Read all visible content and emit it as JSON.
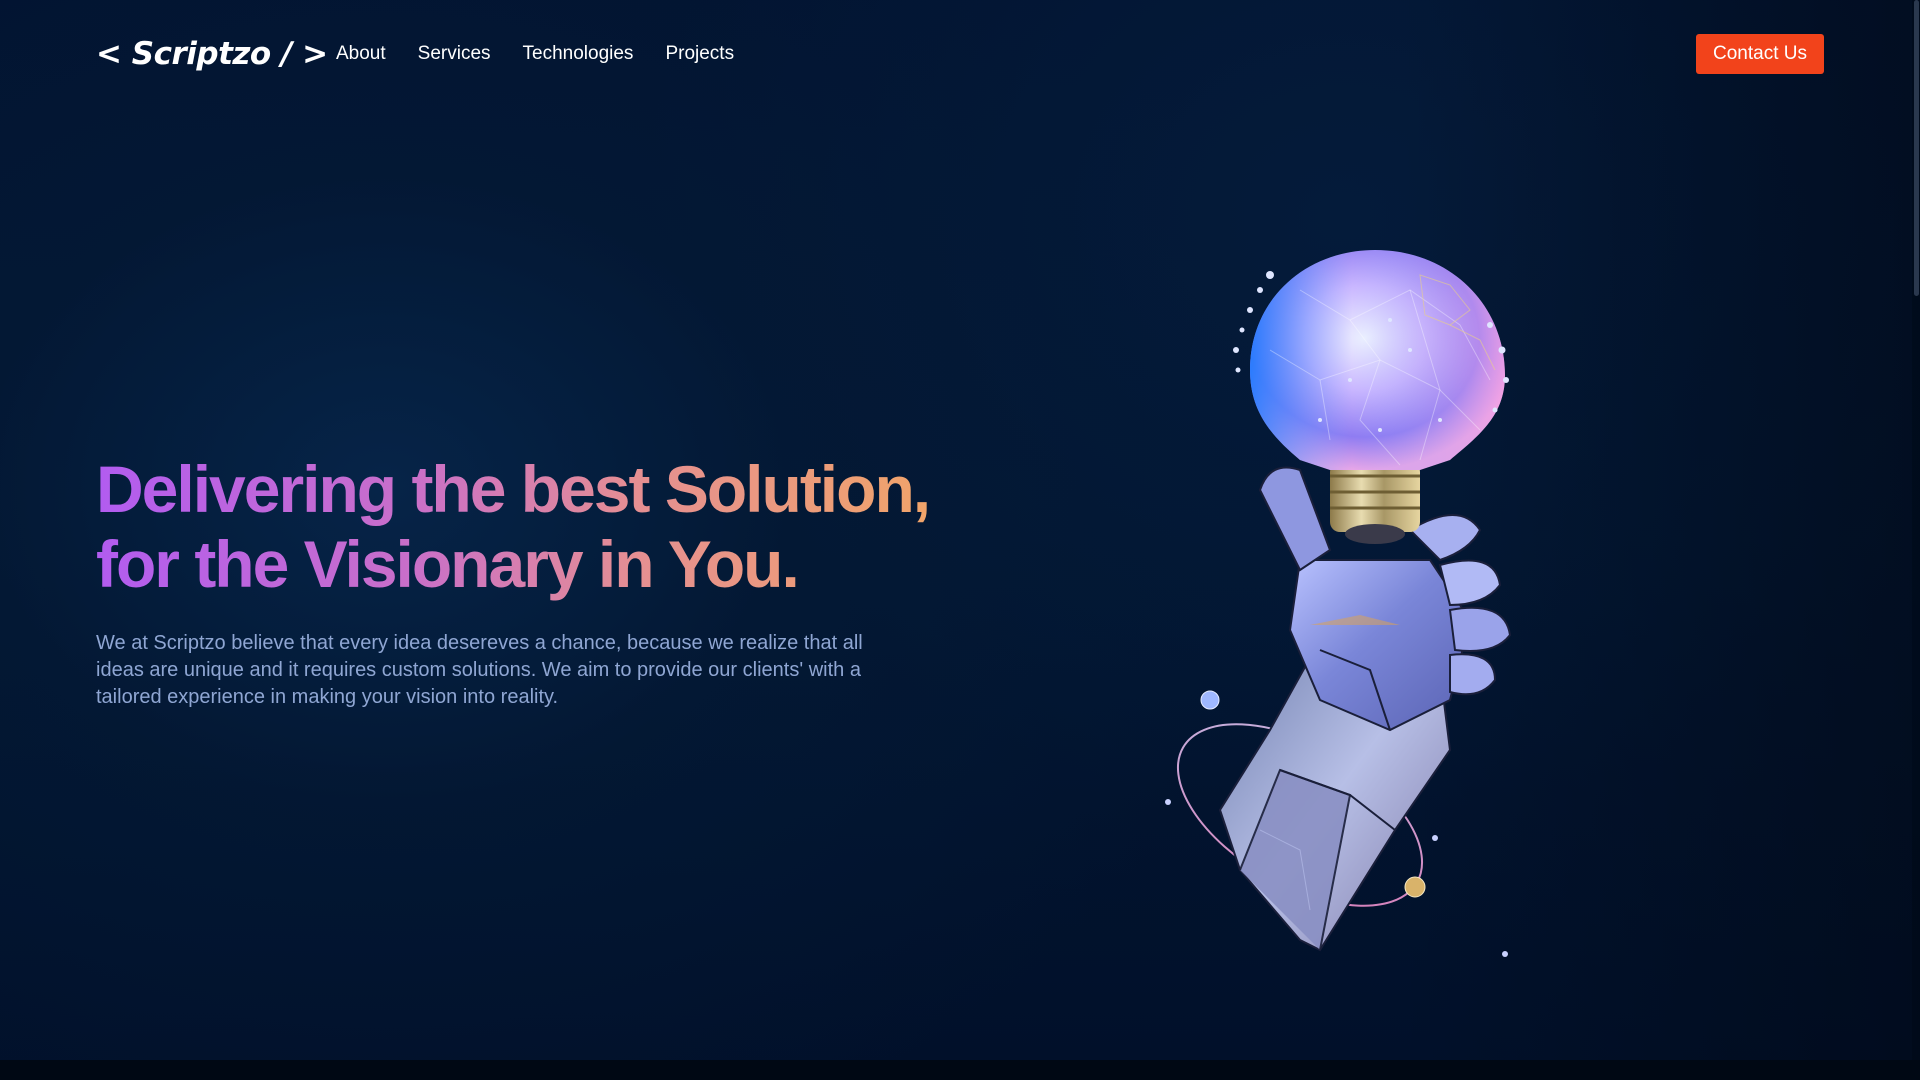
{
  "header": {
    "logo": "< Scriptzo / >",
    "nav_items": [
      {
        "label": "About"
      },
      {
        "label": "Services"
      },
      {
        "label": "Technologies"
      },
      {
        "label": "Projects"
      }
    ],
    "contact_label": "Contact Us"
  },
  "hero": {
    "title_line1": "Delivering the best Solution,",
    "title_line2": "for the Visionary in You.",
    "description": "We at Scriptzo believe that every idea desereves a chance, because we realize that all ideas are unique and it requires custom solutions. We aim to provide our clients' with a tailored experience in making your vision into reality.",
    "illustration": "robotic-hand-holding-lightbulb"
  },
  "colors": {
    "background": "#021632",
    "accent": "#f2431b",
    "title_gradient": [
      "#b25cf0",
      "#e58f92",
      "#f1a46a"
    ],
    "description_text": "#8fa6d3"
  }
}
